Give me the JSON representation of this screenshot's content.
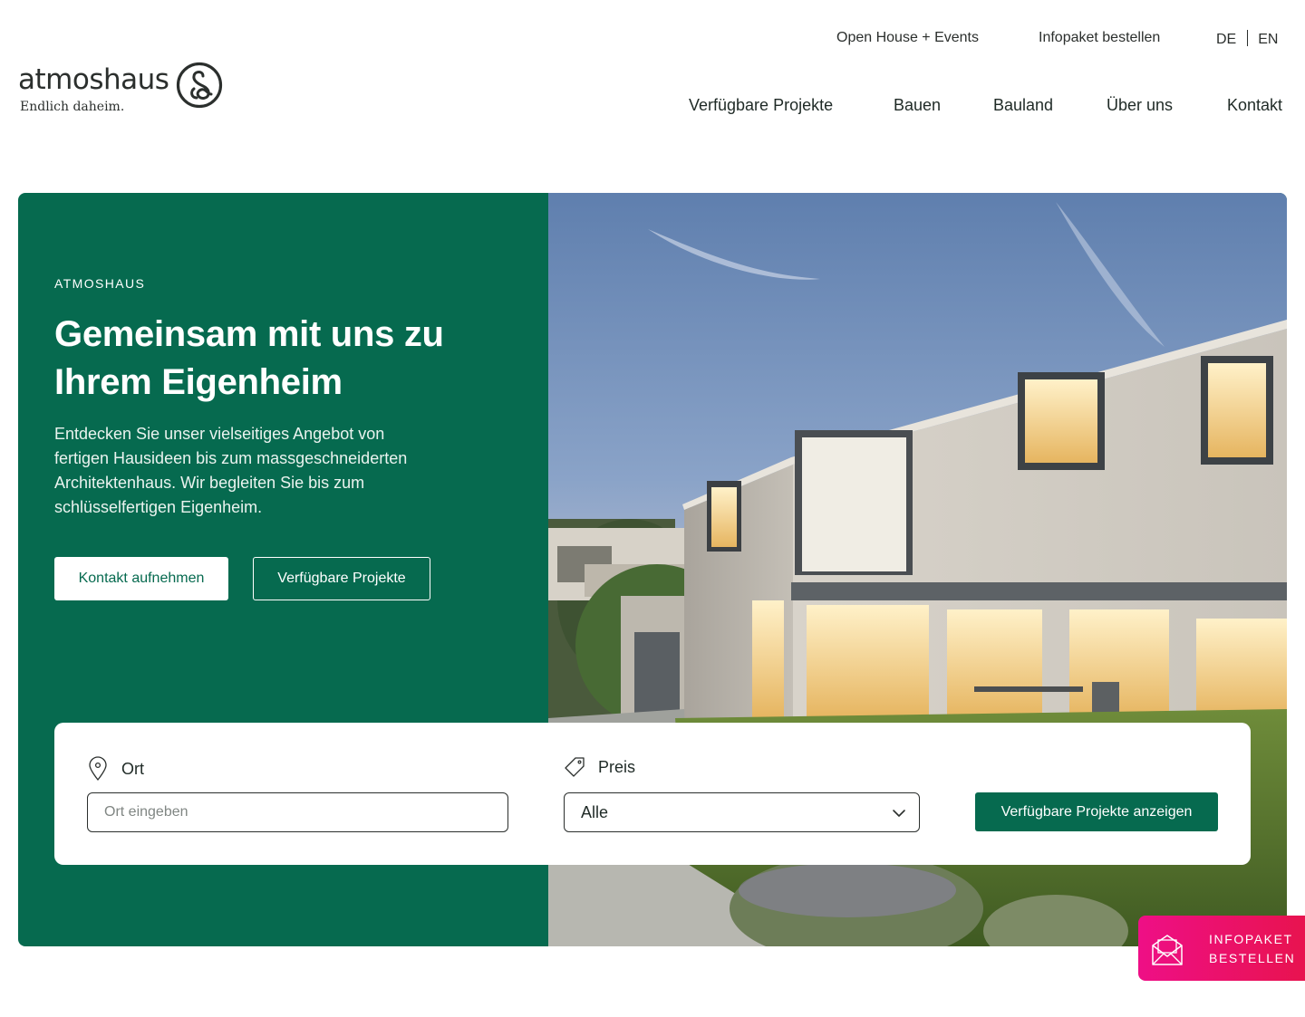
{
  "brand": {
    "name": "atmoshaus",
    "tagline": "Endlich daheim.",
    "mark_color": "#2b2f2d"
  },
  "topnav": {
    "events": "Open House + Events",
    "infopaket": "Infopaket bestellen",
    "lang_de": "DE",
    "lang_en": "EN"
  },
  "mainnav": {
    "items": [
      {
        "label": "Verfügbare Projekte"
      },
      {
        "label": "Bauen"
      },
      {
        "label": "Bauland"
      },
      {
        "label": "Über uns"
      },
      {
        "label": "Kontakt"
      }
    ]
  },
  "hero": {
    "eyebrow": "ATMOSHAUS",
    "title": "Gemeinsam mit uns zu Ihrem Eigenheim",
    "text": "Entdecken Sie unser vielseitiges Angebot von fertigen Hausideen bis zum massgeschneiderten Architektenhaus. Wir begleiten Sie bis zum schlüsselfertigen Eigenheim.",
    "btn_contact": "Kontakt aufnehmen",
    "btn_projects": "Verfügbare Projekte",
    "bg_color": "#066a4f"
  },
  "search": {
    "location_label": "Ort",
    "location_placeholder": "Ort eingeben",
    "price_label": "Preis",
    "price_value": "Alle",
    "submit": "Verfügbare Projekte anzeigen"
  },
  "floater": {
    "line1": "INFOPAKET",
    "line2": "BESTELLEN",
    "color_from": "#ee0f86",
    "color_to": "#e8134f"
  }
}
